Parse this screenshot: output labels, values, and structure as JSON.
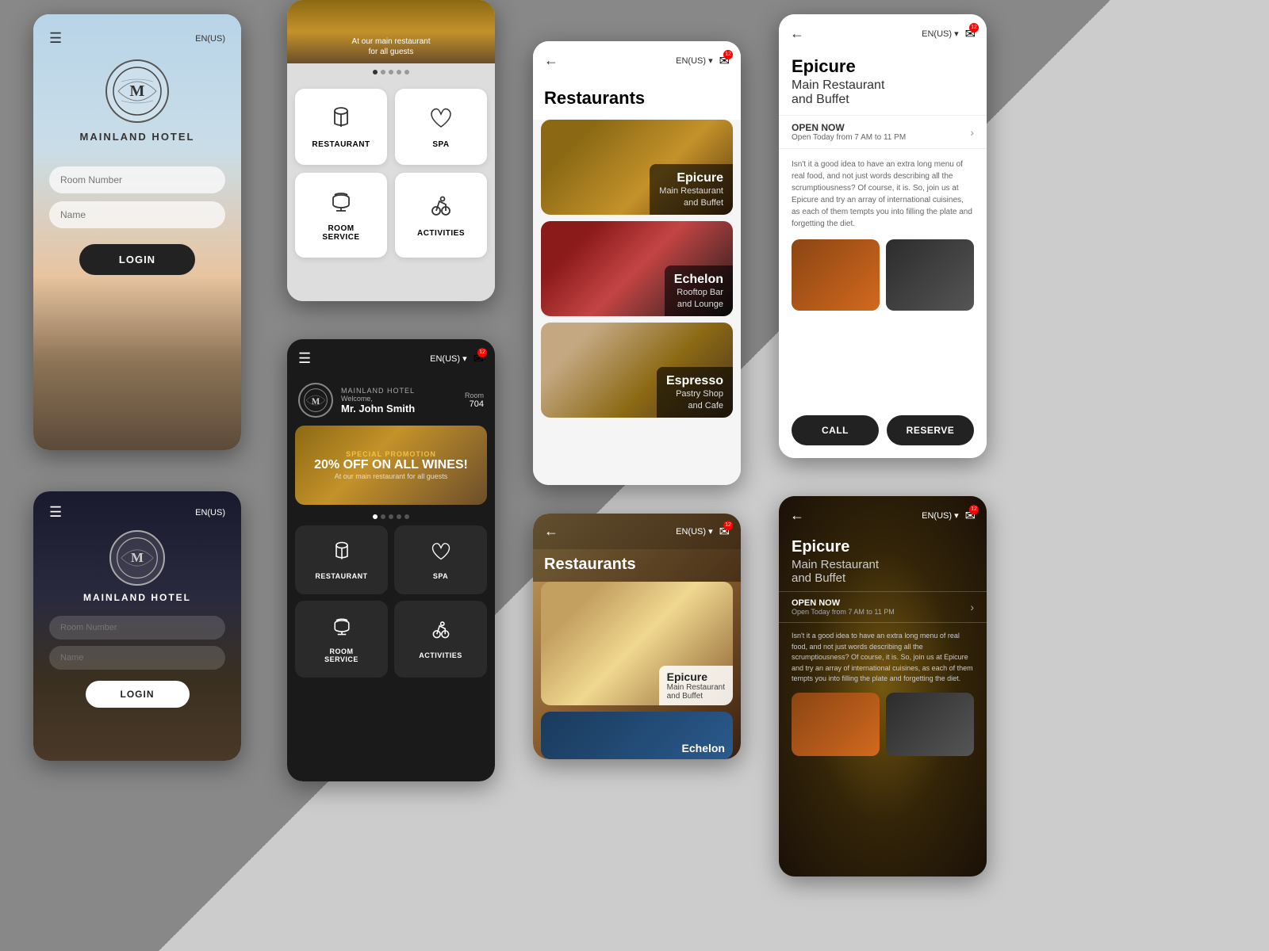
{
  "app": {
    "name": "MAINLAND HOTEL",
    "language": "EN(US)",
    "notification_count": "12"
  },
  "login": {
    "room_number_placeholder": "Room Number",
    "name_placeholder": "Name",
    "login_button": "LOGIN"
  },
  "services": {
    "items": [
      {
        "id": "restaurant",
        "label": "RESTAURANT",
        "icon": "🍽"
      },
      {
        "id": "spa",
        "label": "SPA",
        "icon": "🌸"
      },
      {
        "id": "room_service",
        "label": "ROOM SERVICE",
        "icon": "📞"
      },
      {
        "id": "activities",
        "label": "ACTIVITIES",
        "icon": "🚴"
      }
    ]
  },
  "dashboard": {
    "hotel_name": "MAINLAND HOTEL",
    "welcome": "Welcome,",
    "user_name": "Mr. John Smith",
    "room_label": "Room",
    "room_number": "704",
    "promo_label": "SPECIAL PROMOTION",
    "promo_offer": "20% OFF ON ALL WINES!",
    "promo_sub": "At our main restaurant for all guests"
  },
  "restaurants": {
    "title": "Restaurants",
    "items": [
      {
        "name": "Epicure",
        "subtitle": "Main Restaurant and Buffet",
        "bg_class": "rest-epicure-bg"
      },
      {
        "name": "Echelon",
        "subtitle": "Rooftop Bar and Lounge",
        "bg_class": "rest-echelon-bg"
      },
      {
        "name": "Espresso",
        "subtitle": "Pastry Shop and Cafe",
        "bg_class": "rest-espresso-bg"
      }
    ]
  },
  "restaurant_detail": {
    "name": "Epicure",
    "subtitle_line1": "Main Restaurant",
    "subtitle_line2": "and Buffet",
    "open_status": "OPEN NOW",
    "open_hours": "Open Today from 7 AM to 11 PM",
    "description": "Isn't it a good idea to have an extra long menu of real food, and not just words describing all the scrumptiousness? Of course, it is. So, join us at Epicure and try an array of international cuisines, as each of them tempts you into filling the plate and forgetting the diet.",
    "call_button": "CALL",
    "reserve_button": "RESERVE"
  },
  "promo": {
    "text_line1": "At our main restaurant",
    "text_line2": "for all guests"
  }
}
